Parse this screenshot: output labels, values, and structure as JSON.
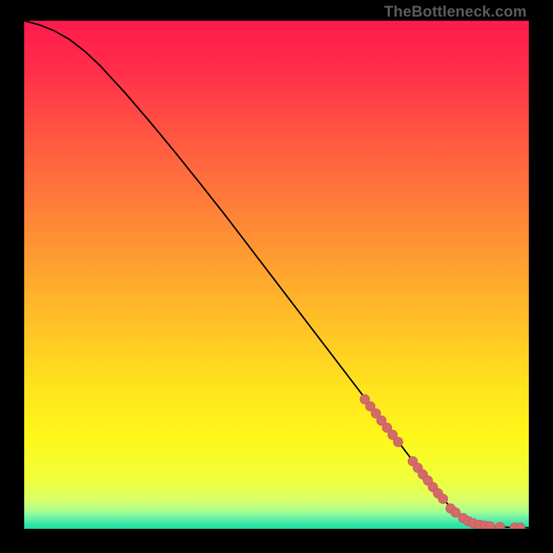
{
  "watermark": "TheBottleneck.com",
  "colors": {
    "gradient_stops": [
      {
        "offset": 0.0,
        "color": "#ff1a4d"
      },
      {
        "offset": 0.1,
        "color": "#ff2f4a"
      },
      {
        "offset": 0.22,
        "color": "#ff5542"
      },
      {
        "offset": 0.35,
        "color": "#ff7a3a"
      },
      {
        "offset": 0.48,
        "color": "#ffa030"
      },
      {
        "offset": 0.6,
        "color": "#ffc226"
      },
      {
        "offset": 0.72,
        "color": "#ffe31e"
      },
      {
        "offset": 0.82,
        "color": "#fff71a"
      },
      {
        "offset": 0.9,
        "color": "#f0ff3a"
      },
      {
        "offset": 0.945,
        "color": "#d7ff6a"
      },
      {
        "offset": 0.965,
        "color": "#a8ff90"
      },
      {
        "offset": 0.98,
        "color": "#66f0a8"
      },
      {
        "offset": 0.992,
        "color": "#2ee6a5"
      },
      {
        "offset": 1.0,
        "color": "#22dca0"
      }
    ],
    "curve": "#000000",
    "marker_fill": "#d46a6a",
    "marker_stroke": "#c95b5b"
  },
  "chart_data": {
    "type": "line",
    "title": "",
    "xlabel": "",
    "ylabel": "",
    "xlim": [
      0,
      100
    ],
    "ylim": [
      0,
      100
    ],
    "series": [
      {
        "name": "curve",
        "x": [
          0,
          3,
          6,
          9,
          12,
          15,
          20,
          25,
          30,
          35,
          40,
          45,
          50,
          55,
          60,
          65,
          70,
          75,
          80,
          82,
          84,
          86,
          88,
          90,
          92,
          94,
          96,
          98,
          100
        ],
        "y": [
          100,
          99.2,
          98.0,
          96.3,
          94.0,
          91.2,
          85.8,
          80.0,
          74.0,
          67.8,
          61.5,
          55.0,
          48.5,
          42.0,
          35.5,
          29.0,
          22.5,
          16.0,
          9.5,
          7.0,
          4.8,
          3.0,
          1.8,
          1.0,
          0.6,
          0.4,
          0.3,
          0.25,
          0.2
        ]
      }
    ],
    "markers": [
      {
        "x": 67.5,
        "y": 25.5
      },
      {
        "x": 68.6,
        "y": 24.1
      },
      {
        "x": 69.7,
        "y": 22.7
      },
      {
        "x": 70.8,
        "y": 21.3
      },
      {
        "x": 71.9,
        "y": 19.9
      },
      {
        "x": 73.0,
        "y": 18.5
      },
      {
        "x": 74.1,
        "y": 17.1
      },
      {
        "x": 77.0,
        "y": 13.3
      },
      {
        "x": 78.0,
        "y": 12.0
      },
      {
        "x": 79.0,
        "y": 10.7
      },
      {
        "x": 80.0,
        "y": 9.5
      },
      {
        "x": 81.0,
        "y": 8.2
      },
      {
        "x": 82.0,
        "y": 7.0
      },
      {
        "x": 83.0,
        "y": 5.9
      },
      {
        "x": 84.5,
        "y": 4.0
      },
      {
        "x": 85.5,
        "y": 3.2
      },
      {
        "x": 87.0,
        "y": 2.1
      },
      {
        "x": 88.0,
        "y": 1.5
      },
      {
        "x": 89.0,
        "y": 1.1
      },
      {
        "x": 90.2,
        "y": 0.8
      },
      {
        "x": 91.3,
        "y": 0.6
      },
      {
        "x": 92.3,
        "y": 0.5
      },
      {
        "x": 94.3,
        "y": 0.35
      },
      {
        "x": 97.2,
        "y": 0.25
      },
      {
        "x": 98.3,
        "y": 0.22
      }
    ]
  }
}
